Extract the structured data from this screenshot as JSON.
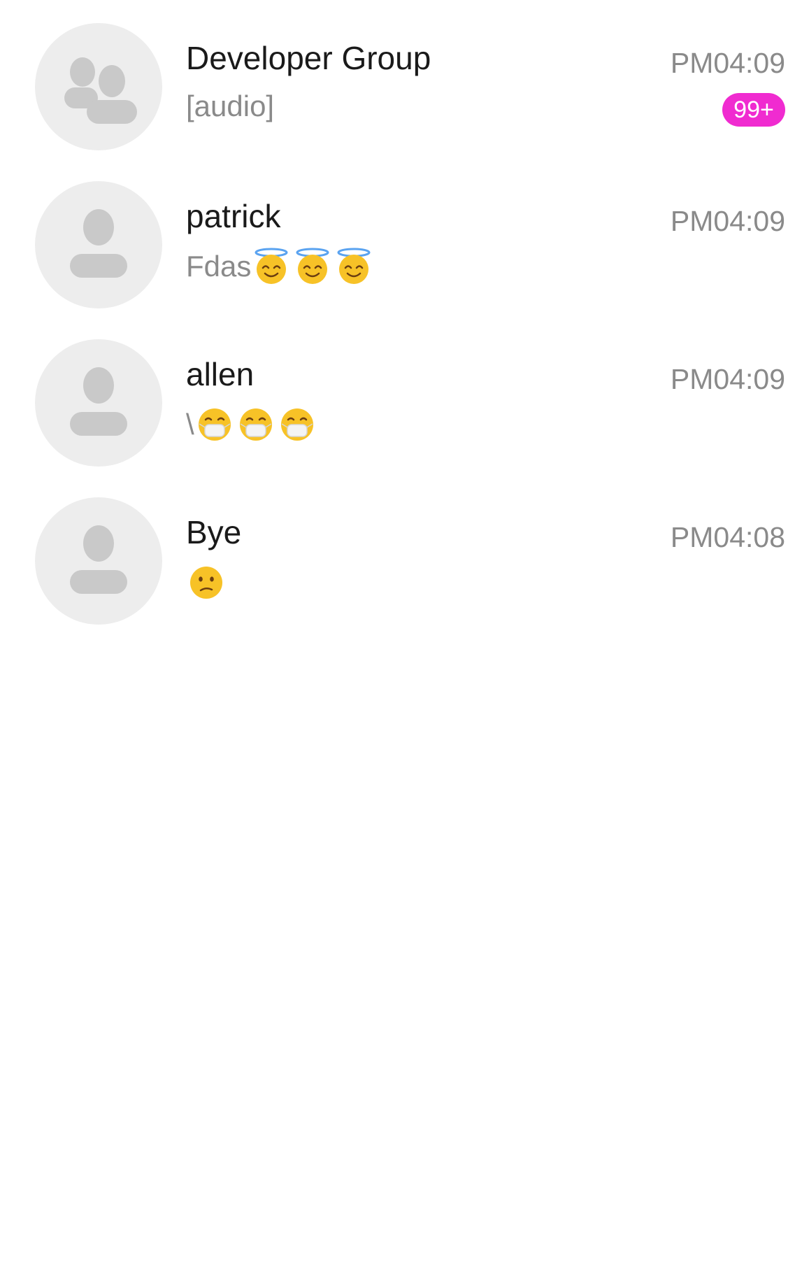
{
  "conversations": [
    {
      "name": "Developer Group",
      "preview": "[audio]",
      "time": "PM04:09",
      "badge": "99+",
      "avatar_icon": "group-icon",
      "emojis": []
    },
    {
      "name": "patrick",
      "preview": "Fdas",
      "time": "PM04:09",
      "avatar_icon": "user-icon",
      "emojis": [
        "halo-smile-emoji",
        "halo-smile-emoji",
        "halo-smile-emoji"
      ]
    },
    {
      "name": "allen",
      "preview": "\\",
      "time": "PM04:09",
      "avatar_icon": "user-icon",
      "emojis": [
        "mask-face-emoji",
        "mask-face-emoji",
        "mask-face-emoji"
      ]
    },
    {
      "name": "Bye",
      "preview": "",
      "time": "PM04:08",
      "avatar_icon": "user-icon",
      "emojis": [
        "confused-face-emoji"
      ]
    }
  ],
  "colors": {
    "badge": "#f02bd0",
    "avatar_bg": "#ededed",
    "avatar_fg": "#c9c9c9",
    "name_text": "#1a1a1a",
    "secondary_text": "#8a8a8a"
  }
}
